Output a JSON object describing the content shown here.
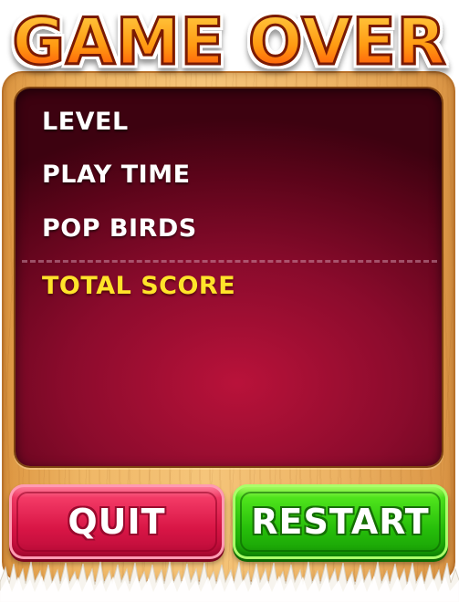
{
  "title": "GAME OVER",
  "stats": {
    "level_label": "LEVEL",
    "play_time_label": "PLAY TIME",
    "pop_birds_label": "POP BIRDS",
    "total_score_label": "TOTAL SCORE"
  },
  "buttons": {
    "quit_label": "QUIT",
    "restart_label": "RESTART"
  },
  "colors": {
    "title_fill": "#ff9a12",
    "panel_bg": "#8a0b2c",
    "total_score_text": "#ffe32a",
    "quit_button": "#d81545",
    "restart_button": "#26be0a",
    "wood": "#efb766"
  }
}
